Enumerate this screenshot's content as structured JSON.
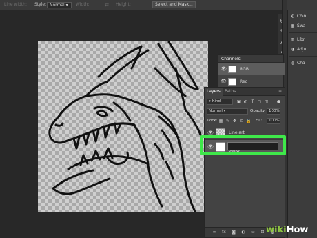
{
  "options_bar": {
    "line_width_label": "Line width:",
    "style_label": "Style:",
    "style_value": "Normal",
    "width_label": "Width:",
    "height_label": "Height:",
    "select_mask_label": "Select and Mask..."
  },
  "right_panel": {
    "items": [
      {
        "icon": "color-icon",
        "label": "Colo"
      },
      {
        "icon": "swatches-icon",
        "label": "Swa"
      },
      {
        "icon": "libraries-icon",
        "label": "Libr"
      },
      {
        "icon": "adjustments-icon",
        "label": "Adju"
      },
      {
        "icon": "channels-icon",
        "label": "Cha"
      }
    ]
  },
  "channels": {
    "title": "Channels",
    "rows": [
      {
        "label": "RGB",
        "active": true
      },
      {
        "label": "Red",
        "active": false
      }
    ]
  },
  "layers": {
    "tabs": [
      {
        "label": "Layers",
        "active": true
      },
      {
        "label": "Paths",
        "active": false
      }
    ],
    "filter_label": "Kind",
    "blend_mode": "Normal",
    "opacity_label": "Opacity:",
    "opacity_value": "100%",
    "lock_label": "Lock:",
    "fill_label": "Fill:",
    "fill_value": "100%",
    "items": [
      {
        "name": "Line art",
        "active": false
      },
      {
        "name_input_value": "color",
        "active": true
      }
    ]
  },
  "watermark": {
    "prefix": "wiki",
    "suffix": "How"
  },
  "colors": {
    "highlight": "#3fe84a",
    "panel": "#434343",
    "background": "#2b2b2b"
  }
}
